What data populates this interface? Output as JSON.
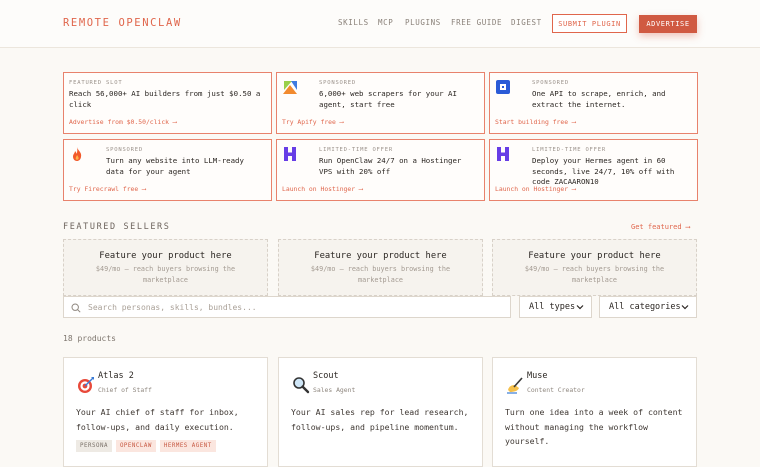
{
  "header": {
    "logo": "REMOTE OPENCLAW",
    "nav": [
      "SKILLS",
      "MCP",
      "PLUGINS",
      "FREE GUIDE",
      "DIGEST"
    ],
    "submit_label": "SUBMIT PLUGIN",
    "advertise_label": "ADVERTISE"
  },
  "ads": [
    {
      "tag": "FEATURED SLOT",
      "text": "Reach 56,000+ AI builders from just $0.50 a click",
      "cta": "Advertise from $0.50/click ⟶",
      "icon": ""
    },
    {
      "tag": "SPONSORED",
      "text": "6,000+ web scrapers for your AI agent, start free",
      "cta": "Try Apify free ⟶",
      "icon": "apify-logo-icon"
    },
    {
      "tag": "SPONSORED",
      "text": "One API to scrape, enrich, and extract the internet.",
      "cta": "Start building free ⟶",
      "icon": "api-logo-icon"
    },
    {
      "tag": "SPONSORED",
      "text": "Turn any website into LLM-ready data for your agent",
      "cta": "Try Firecrawl free ⟶",
      "icon": "firecrawl-flame-icon"
    },
    {
      "tag": "LIMITED-TIME OFFER",
      "text": "Run OpenClaw 24/7 on a Hostinger VPS with 20% off",
      "cta": "Launch on Hostinger ⟶",
      "icon": "hostinger-logo-icon"
    },
    {
      "tag": "LIMITED-TIME OFFER",
      "text": "Deploy your Hermes agent in 60 seconds, live 24/7, 10% off with code ZACAARON10",
      "cta": "Launch on Hostinger ⟶",
      "icon": "hostinger-logo-icon"
    }
  ],
  "featured": {
    "title": "FEATURED SELLERS",
    "link": "Get featured ⟶",
    "slots": [
      {
        "title": "Feature your product here",
        "sub": "$49/mo — reach buyers browsing the marketplace"
      },
      {
        "title": "Feature your product here",
        "sub": "$49/mo — reach buyers browsing the marketplace"
      },
      {
        "title": "Feature your product here",
        "sub": "$49/mo — reach buyers browsing the marketplace"
      }
    ]
  },
  "filters": {
    "search_placeholder": "Search personas, skills, bundles...",
    "type": "All types",
    "category": "All categories"
  },
  "count": "18 products",
  "products": [
    {
      "name": "Atlas 2",
      "role": "Chief of Staff",
      "desc": "Your AI chief of staff for inbox, follow-ups, and daily execution.",
      "icon": "target-dart-icon",
      "tags": [
        "PERSONA",
        "OPENCLAW",
        "HERMES AGENT"
      ]
    },
    {
      "name": "Scout",
      "role": "Sales Agent",
      "desc": "Your AI sales rep for lead research, follow-ups, and pipeline momentum.",
      "icon": "magnifier-icon",
      "tags": []
    },
    {
      "name": "Muse",
      "role": "Content Creator",
      "desc": "Turn one idea into a week of content without managing the workflow yourself.",
      "icon": "writing-hand-icon",
      "tags": []
    }
  ],
  "colors": {
    "accent": "#e0664c",
    "accent_dark": "#d05a42",
    "background": "#fbf9f5"
  }
}
